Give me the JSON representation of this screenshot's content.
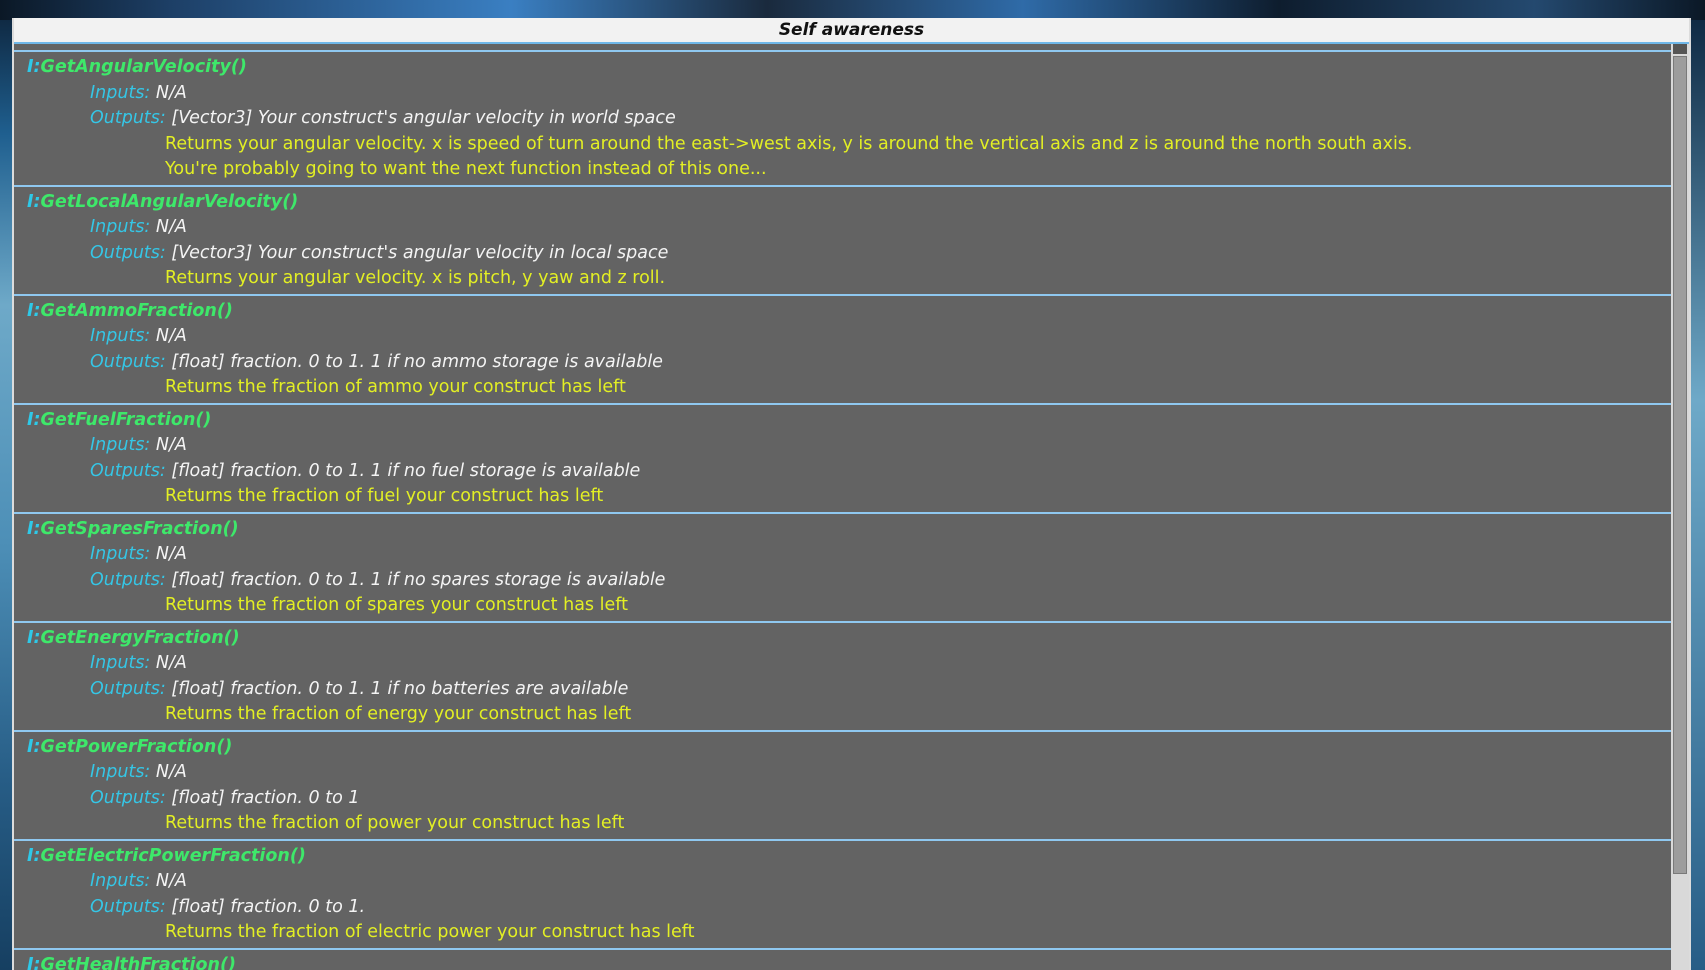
{
  "window": {
    "title": "Self awareness"
  },
  "labels": {
    "prefix": "I:",
    "inputs": "Inputs:",
    "outputs": "Outputs:"
  },
  "entries": [
    {
      "name": "GetAngularVelocity()",
      "inputs": "N/A",
      "outputs": "[Vector3] Your construct's angular velocity in world space",
      "desc": [
        "Returns your angular velocity. x is speed of turn around the east->west axis, y is around the vertical axis and z is around the north south axis.",
        "You're probably going to want the next function instead of this one..."
      ]
    },
    {
      "name": "GetLocalAngularVelocity()",
      "inputs": "N/A",
      "outputs": "[Vector3] Your construct's angular velocity in local space",
      "desc": [
        "Returns your angular velocity. x is pitch, y yaw and z roll."
      ]
    },
    {
      "name": "GetAmmoFraction()",
      "inputs": "N/A",
      "outputs": "[float] fraction. 0 to 1. 1 if no ammo storage is available",
      "desc": [
        "Returns the fraction of ammo your construct has left"
      ]
    },
    {
      "name": "GetFuelFraction()",
      "inputs": "N/A",
      "outputs": "[float] fraction. 0 to 1. 1 if no fuel storage is available",
      "desc": [
        "Returns the fraction of fuel your construct has left"
      ]
    },
    {
      "name": "GetSparesFraction()",
      "inputs": "N/A",
      "outputs": "[float] fraction. 0 to 1. 1 if no spares storage is available",
      "desc": [
        "Returns the fraction of spares your construct has left"
      ]
    },
    {
      "name": "GetEnergyFraction()",
      "inputs": "N/A",
      "outputs": "[float] fraction. 0 to 1. 1 if no batteries are available",
      "desc": [
        "Returns the fraction of energy your construct has left"
      ]
    },
    {
      "name": "GetPowerFraction()",
      "inputs": "N/A",
      "outputs": "[float] fraction. 0 to 1",
      "desc": [
        "Returns the fraction of power your construct has left"
      ]
    },
    {
      "name": "GetElectricPowerFraction()",
      "inputs": "N/A",
      "outputs": "[float] fraction. 0 to 1.",
      "desc": [
        "Returns the fraction of electric power your construct has left"
      ]
    },
    {
      "name": "GetHealthFraction()",
      "inputs": "N/A",
      "outputs": "",
      "desc": []
    }
  ]
}
